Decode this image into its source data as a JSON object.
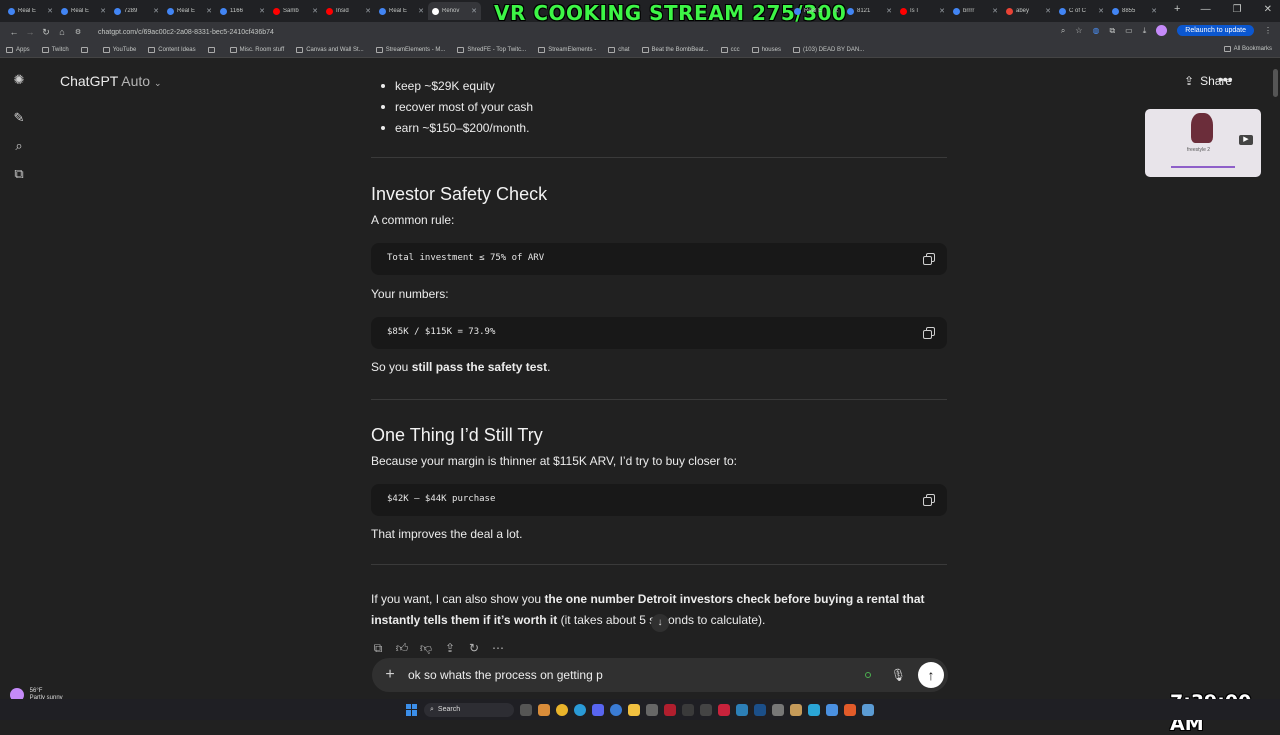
{
  "browser": {
    "tabs": [
      {
        "label": "Real E",
        "color": "#4285f4"
      },
      {
        "label": "Real E",
        "color": "#4285f4"
      },
      {
        "label": "7289",
        "color": "#4285f4"
      },
      {
        "label": "Real E",
        "color": "#4285f4"
      },
      {
        "label": "1166",
        "color": "#4285f4"
      },
      {
        "label": "Samb",
        "color": "#ff0000"
      },
      {
        "label": "Insid",
        "color": "#ff0000"
      },
      {
        "label": "Real E",
        "color": "#4285f4"
      },
      {
        "label": "Renov",
        "color": "#ffffff",
        "active": true
      }
    ],
    "tabs_right": [
      {
        "label": "Real E",
        "color": "#4285f4"
      },
      {
        "label": "8121",
        "color": "#4285f4"
      },
      {
        "label": "Is I",
        "color": "#ff0000"
      },
      {
        "label": "brrrr",
        "color": "#4285f4"
      },
      {
        "label": "abey",
        "color": "#ea4335"
      },
      {
        "label": "C of C",
        "color": "#4285f4"
      },
      {
        "label": "8855",
        "color": "#4285f4"
      }
    ],
    "new_tab": "+",
    "url": "chatgpt.com/c/69ac00c2-2a08-8331-bec5-2410cf436b74",
    "relaunch_label": "Relaunch to update",
    "window_controls": [
      "—",
      "❐",
      "✕"
    ]
  },
  "overlay": {
    "stream_title": "VR COOKING STREAM 275/300",
    "clock": "7:39:00 AM"
  },
  "bookmarks": {
    "items": [
      "Apps",
      "Twitch",
      "",
      "YouTube",
      "Content Ideas",
      "",
      "Misc. Room stuff",
      "Canvas and Wall St...",
      "StreamElements - M...",
      "ShredFE - Top Twitc...",
      "StreamElements -",
      "chat",
      "Beat the BombBeat...",
      "ccc",
      "houses",
      "(103) DEAD BY DAN..."
    ],
    "all_label": "All Bookmarks"
  },
  "header": {
    "model": "ChatGPT",
    "model_mode": "Auto",
    "share_label": "Share",
    "more": "•••"
  },
  "video_thumb": {
    "title": "freestyle 2"
  },
  "message": {
    "bullets": [
      "keep ~$29K equity",
      "recover most of your cash",
      "earn ~$150–$200/month."
    ],
    "s1_heading": "Investor Safety Check",
    "s1_intro": "A common rule:",
    "s1_code": "Total investment ≤ 75% of ARV",
    "s1_numbers_label": "Your numbers:",
    "s1_code2": "$85K / $115K = 73.9%",
    "s1_conclusion_a": "So you ",
    "s1_conclusion_b": "still pass the safety test",
    "s1_conclusion_c": ".",
    "s2_heading": "One Thing I’d Still Try",
    "s2_intro": "Because your margin is thinner at $115K ARV, I’d try to buy closer to:",
    "s2_code": "$42K – $44K purchase",
    "s2_conclusion": "That improves the deal a lot.",
    "final_a": "If you want, I can also show you ",
    "final_b": "the one number Detroit investors check before buying a rental that instantly tells them if it’s worth it",
    "final_c": " (it takes about 5 seconds to calculate)."
  },
  "composer": {
    "value": "ok so whats the process on getting p",
    "plus": "+"
  },
  "weather": {
    "temp": "56°F",
    "condition": "Partly sunny"
  },
  "taskbar": {
    "search_label": "Search"
  }
}
